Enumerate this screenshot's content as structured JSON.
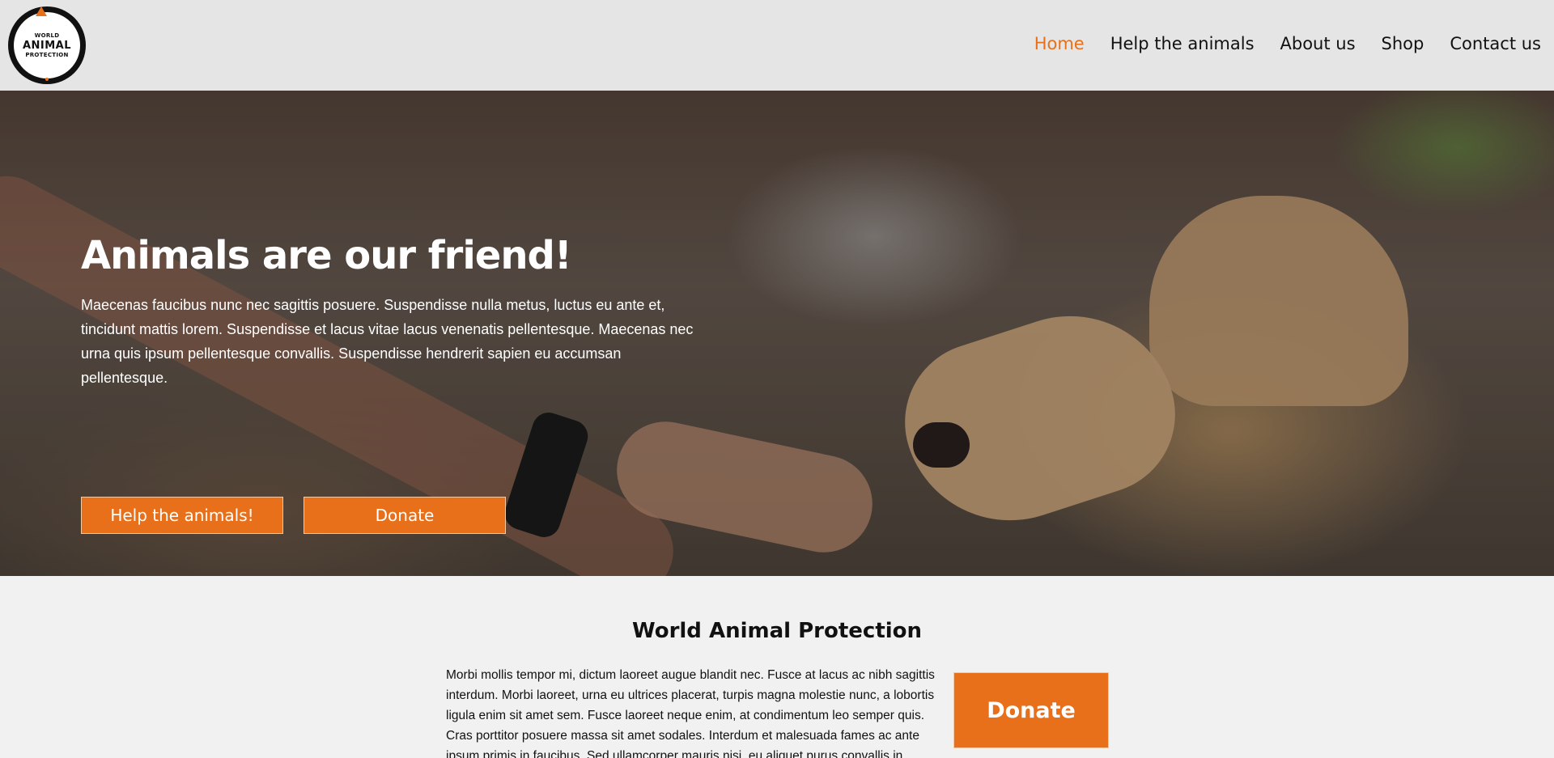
{
  "header": {
    "logo": {
      "line1": "WORLD",
      "line2": "ANIMAL",
      "line3": "PROTECTION"
    },
    "nav": [
      {
        "label": "Home",
        "active": true
      },
      {
        "label": "Help the animals",
        "active": false
      },
      {
        "label": "About us",
        "active": false
      },
      {
        "label": "Shop",
        "active": false
      },
      {
        "label": "Contact us",
        "active": false
      }
    ]
  },
  "hero": {
    "title": "Animals are our friend!",
    "text": "Maecenas faucibus nunc nec sagittis posuere. Suspendisse nulla metus, luctus eu ante et, tincidunt mattis lorem. Suspendisse et lacus vitae lacus venenatis pellentesque. Maecenas nec urna quis ipsum pellentesque convallis. Suspendisse hendrerit sapien eu accumsan pellentesque.",
    "primary_button": "Help the animals!",
    "secondary_button": "Donate"
  },
  "about": {
    "title": "World Animal Protection",
    "text": "Morbi mollis tempor mi, dictum laoreet augue blandit nec. Fusce at lacus ac nibh sagittis interdum. Morbi laoreet, urna eu ultrices placerat, turpis magna molestie nunc, a lobortis ligula enim sit amet sem. Fusce laoreet neque enim, at condimentum leo semper quis. Cras porttitor posuere massa sit amet sodales. Interdum et malesuada fames ac ante ipsum primis in faucibus. Sed ullamcorper mauris nisi, eu aliquet purus convallis in.",
    "donate_button": "Donate"
  },
  "colors": {
    "accent": "#e8701a",
    "header_bg": "#e5e5e5",
    "page_bg": "#f1f1f1"
  }
}
